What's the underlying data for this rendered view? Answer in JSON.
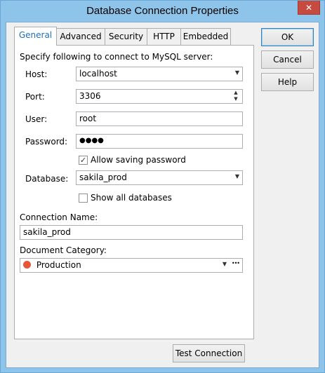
{
  "window": {
    "title": "Database Connection Properties",
    "close_glyph": "✕"
  },
  "tabs": [
    {
      "label": "General",
      "active": true
    },
    {
      "label": "Advanced"
    },
    {
      "label": "Security"
    },
    {
      "label": "HTTP"
    },
    {
      "label": "Embedded"
    }
  ],
  "general": {
    "intro": "Specify following to connect to MySQL server:",
    "host_label": "Host:",
    "host_value": "localhost",
    "port_label": "Port:",
    "port_value": "3306",
    "user_label": "User:",
    "user_value": "root",
    "password_label": "Password:",
    "password_value": "●●●●",
    "allow_saving_label": "Allow saving password",
    "allow_saving_checked": true,
    "database_label": "Database:",
    "database_value": "sakila_prod",
    "show_all_label": "Show all databases",
    "show_all_checked": false,
    "connection_name_label": "Connection Name:",
    "connection_name_value": "sakila_prod",
    "document_category_label": "Document Category:",
    "document_category_value": "Production",
    "document_category_color": "#e8563a",
    "ellipsis": "•••"
  },
  "buttons": {
    "ok": "OK",
    "cancel": "Cancel",
    "help": "Help",
    "test_connection": "Test Connection"
  },
  "icons": {
    "close": "close-icon",
    "combo_arrow": "chevron-down-icon",
    "spin_up": "spin-up-icon",
    "spin_down": "spin-down-icon",
    "check": "check-icon"
  }
}
